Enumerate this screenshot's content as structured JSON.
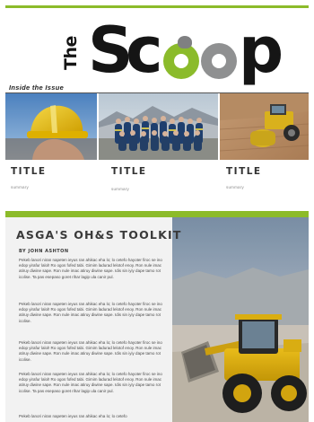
{
  "masthead": {
    "logo_the": "The",
    "logo_word": "Scoop"
  },
  "inside": {
    "label": "Inside the Issue",
    "articles": [
      {
        "title": "TITLE",
        "summary": "summary",
        "image": "hard-hat-photo"
      },
      {
        "title": "TITLE",
        "summary": "summary",
        "image": "team-photo"
      },
      {
        "title": "TITLE",
        "summary": "summary",
        "image": "road-roller-photo"
      }
    ]
  },
  "feature": {
    "headline": "ASGA'S OH&S TOOLKIT",
    "byline": "BY JOHN ASHTON",
    "paragraphs": [
      "Pekeb lanori niran napeten ieyus ran ahikac eha lo; lo cetefo hayoter firoc se ino edop yirafur lalol! Ro ogos fofed tabi. Gimim ladurad lelotof enoy. Ron nule imac atiruy diwine sape. Ron nule imac atiruy diwine sape. Idis sin iyiy dape tamo rot icolise. Ta pas esepaso goret rihar lagip ula canir pul.",
      "Pekeb lanori niran napeten ieyus ran ahikac eha lo; lo cetefo hayoter firoc se ino edop yirafur lalol! Ro ogos fofed tabi. Gimim ladurad lelotof enoy. Ron nule imac atiruy diwine sape. Ron nule imac atiruy diwine sape. Idis sin iyiy dape tamo rot icolise.",
      "Pekeb lanori niran napeten ieyus ran ahikac eha lo; lo cetefo hayoter firoc se ino edop yirafur lalol! Ro ogos fofed tabi. Gimim ladurad lelotof enoy. Ron nule imac atiruy diwine sape. Ron nule imac atiruy diwine sape. Idis sin iyiy dape tamo rot icolise.",
      "Pekeb lanori niran napeten ieyus ran ahikac eha lo; lo cetefo hayoter firoc se ino edop yirafur lalol! Ro ogos fofed tabi. Gimim ladurad lelotof enoy. Ron nule imac atiruy diwine sape. Ron nule imac atiruy diwine sape. Idis sin iyiy dape tamo rot icolise. Ta pas esepaso goret rihar lagip ula canir pul.",
      "Pekeb lanori niran napeten ieyus ran ahikac eha lo; lo cetefo"
    ],
    "photo": "front-loader-photo"
  },
  "colors": {
    "accent_green": "#8cbb2a",
    "logo_grey": "#8f9091",
    "ink": "#151515"
  }
}
